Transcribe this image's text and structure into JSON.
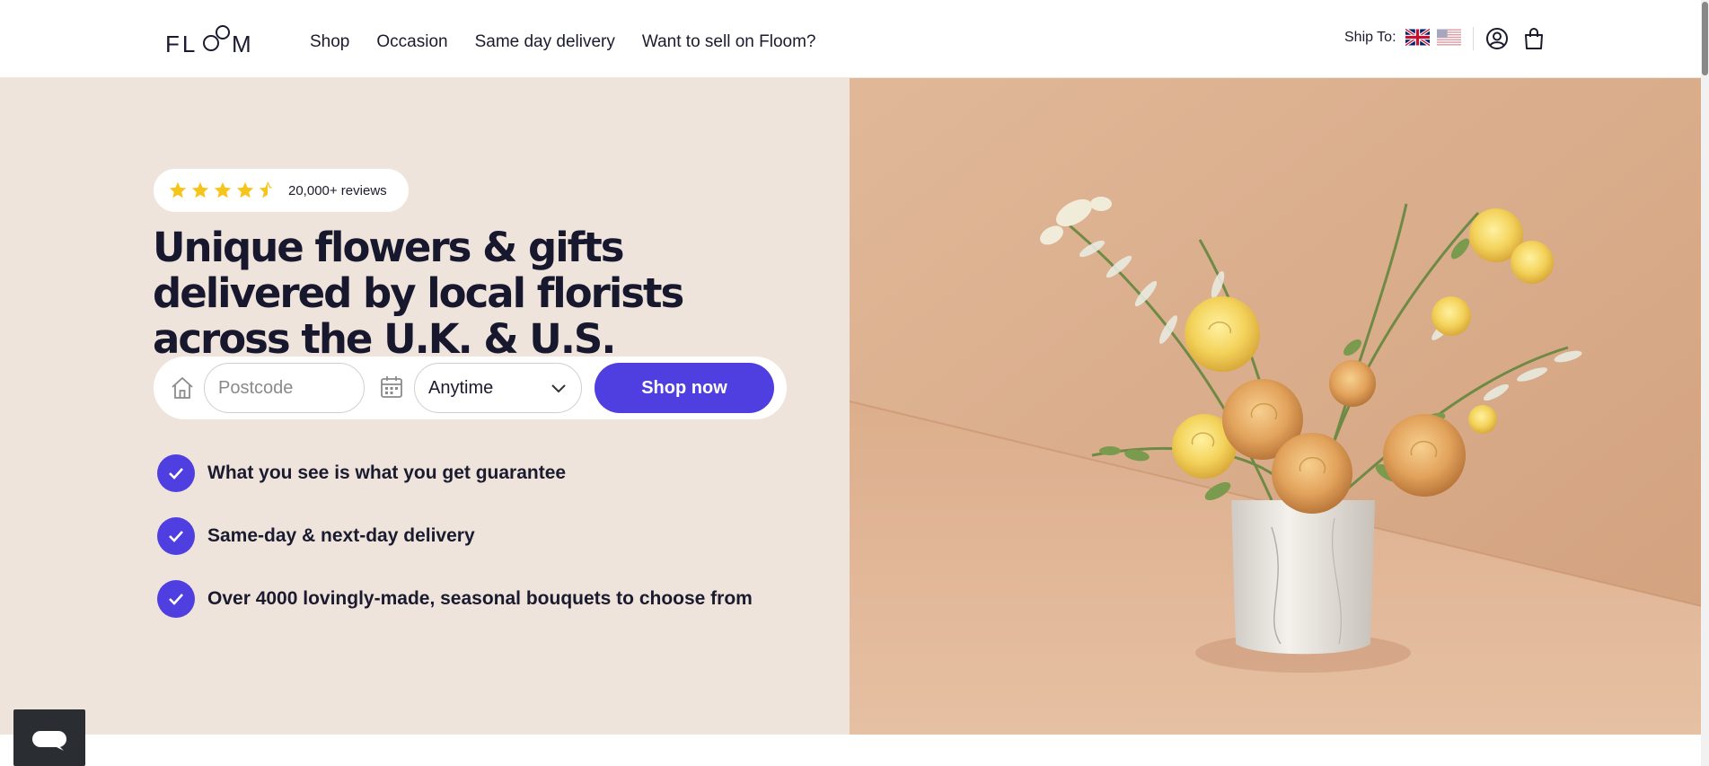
{
  "header": {
    "logo_text": "FLOOM",
    "nav": [
      "Shop",
      "Occasion",
      "Same day delivery",
      "Want to sell on Floom?"
    ],
    "ship_to_label": "Ship To:",
    "flags": [
      "uk-flag-icon",
      "us-flag-icon"
    ],
    "icons": [
      "account-icon",
      "bag-icon"
    ]
  },
  "hero": {
    "rating": {
      "stars": 4.5,
      "reviews_text": "20,000+ reviews"
    },
    "headline": "Unique flowers & gifts delivered by local florists across the U.K. & U.S.",
    "search": {
      "postcode_placeholder": "Postcode",
      "date_value": "Anytime",
      "button_label": "Shop now"
    },
    "benefits": [
      "What you see is what you get guarantee",
      "Same-day & next-day delivery",
      "Over 4000 lovingly-made, seasonal bouquets to choose from"
    ],
    "image": "bouquet-in-marble-vase"
  },
  "colors": {
    "accent": "#4f3fe0",
    "hero_left_bg": "#efe4dc",
    "hero_right_bg": "#deb496",
    "star": "#f7c41b",
    "text": "#1b1b2f"
  },
  "chat": {
    "icon": "chat-icon"
  }
}
